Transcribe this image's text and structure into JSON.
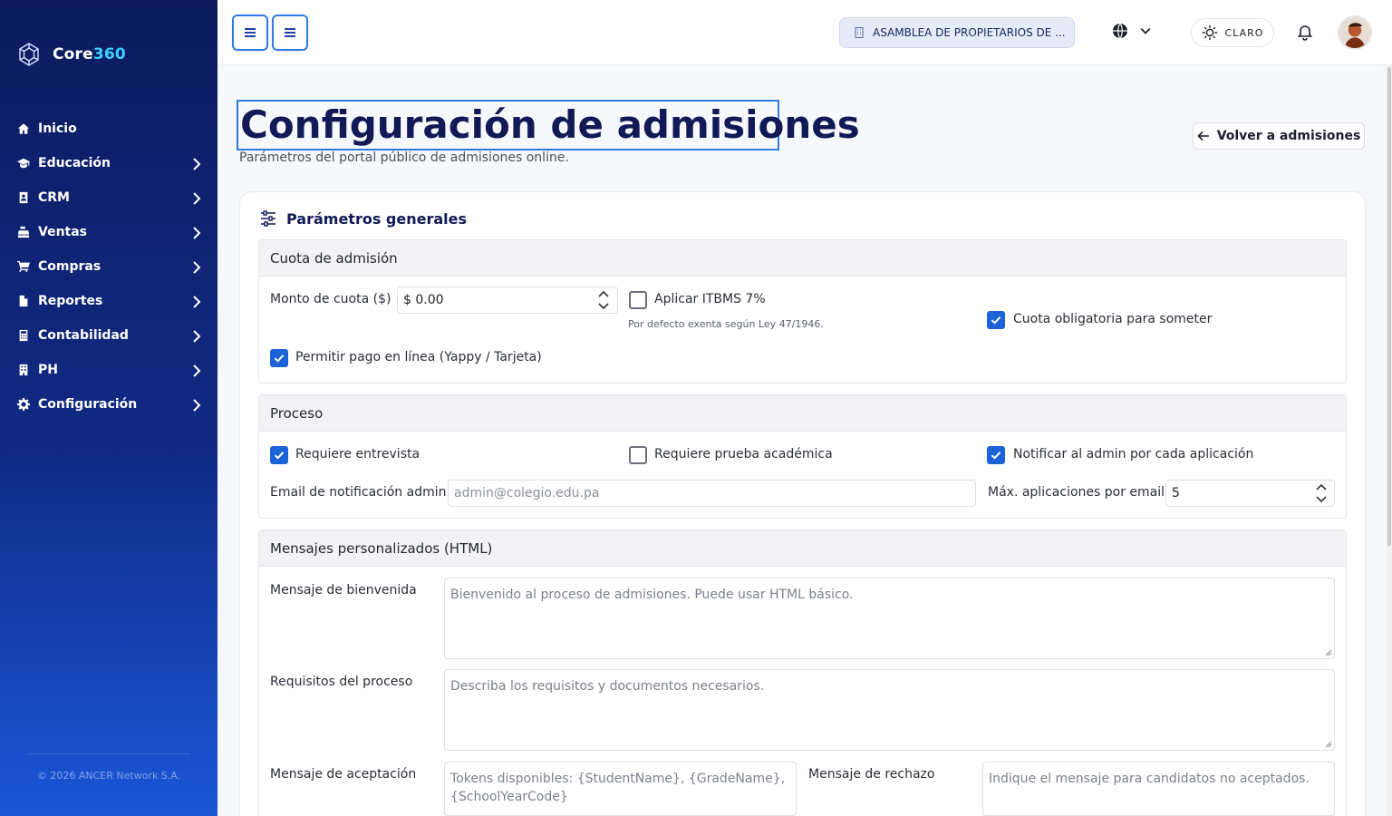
{
  "sidebar": {
    "brand_prefix": "Core",
    "brand_suffix": "360",
    "items": [
      {
        "label": "Inicio",
        "icon": "home-icon"
      },
      {
        "label": "Educación",
        "icon": "graduation-cap-icon"
      },
      {
        "label": "CRM",
        "icon": "address-book-icon"
      },
      {
        "label": "Ventas",
        "icon": "cash-register-icon"
      },
      {
        "label": "Compras",
        "icon": "shopping-cart-icon"
      },
      {
        "label": "Reportes",
        "icon": "file-icon"
      },
      {
        "label": "Contabilidad",
        "icon": "calculator-icon"
      },
      {
        "label": "PH",
        "icon": "building-icon"
      },
      {
        "label": "Configuración",
        "icon": "gear-icon"
      }
    ],
    "copyright": "© 2026 ANCER Network S.A."
  },
  "topbar": {
    "organization": "ASAMBLEA DE PROPIETARIOS DE ...",
    "theme_label": "CLARO"
  },
  "header": {
    "title": "Configuración de admisiones",
    "subtitle": "Parámetros del portal público de admisiones online.",
    "back_label": "Volver a admisiones"
  },
  "card": {
    "title": "Parámetros generales"
  },
  "fee": {
    "section_title": "Cuota de admisión",
    "amount_label": "Monto de cuota ($)",
    "amount_value": "$ 0.00",
    "itbms_label": "Aplicar ITBMS 7%",
    "itbms_checked": false,
    "itbms_hint": "Por defecto exenta según Ley 47/1946.",
    "mandatory_label": "Cuota obligatoria para someter",
    "mandatory_checked": true,
    "online_label": "Permitir pago en línea (Yappy / Tarjeta)",
    "online_checked": true
  },
  "process": {
    "section_title": "Proceso",
    "interview_label": "Requiere entrevista",
    "interview_checked": true,
    "test_label": "Requiere prueba académica",
    "test_checked": false,
    "notify_label": "Notificar al admin por cada aplicación",
    "notify_checked": true,
    "email_label": "Email de notificación admin",
    "email_placeholder": "admin@colegio.edu.pa",
    "max_label": "Máx. aplicaciones por email",
    "max_value": "5"
  },
  "messages": {
    "section_title": "Mensajes personalizados (HTML)",
    "welcome_label": "Mensaje de bienvenida",
    "welcome_placeholder": "Bienvenido al proceso de admisiones. Puede usar HTML básico.",
    "requirements_label": "Requisitos del proceso",
    "requirements_placeholder": "Describa los requisitos y documentos necesarios.",
    "acceptance_label": "Mensaje de aceptación",
    "acceptance_placeholder": "Tokens disponibles: {StudentName}, {GradeName}, {SchoolYearCode}",
    "rejection_label": "Mensaje de rechazo",
    "rejection_placeholder": "Indique el mensaje para candidatos no aceptados."
  },
  "colors": {
    "sidebar_top": "#0d1b5e",
    "sidebar_bottom": "#1a56d8",
    "accent": "#1d63d8",
    "title": "#111a56"
  }
}
